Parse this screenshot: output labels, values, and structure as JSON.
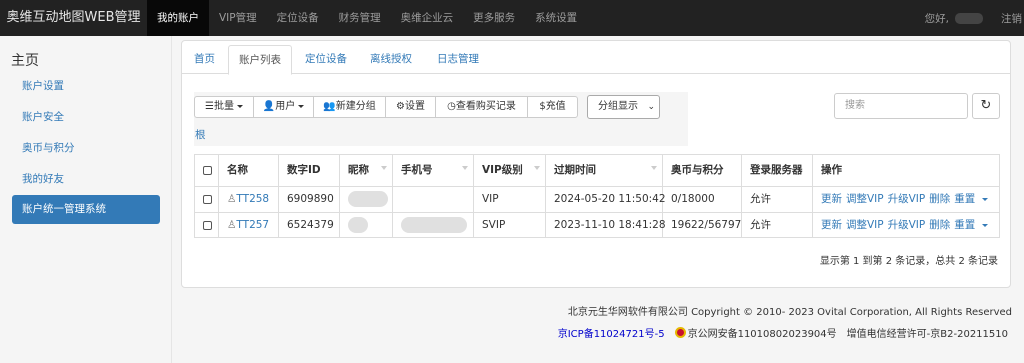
{
  "nav": {
    "brand": "奥维互动地图WEB管理",
    "items": [
      "我的账户",
      "VIP管理",
      "定位设备",
      "财务管理",
      "奥维企业云",
      "更多服务",
      "系统设置"
    ],
    "greeting": "您好,",
    "logout": "注销"
  },
  "sidebar": {
    "title": "主页",
    "items": [
      "账户设置",
      "账户安全",
      "奥币与积分",
      "我的好友",
      "账户统一管理系统"
    ]
  },
  "tabs": [
    "首页",
    "账户列表",
    "定位设备",
    "离线授权",
    "日志管理"
  ],
  "toolbar": {
    "batch": "批量",
    "user": "用户",
    "new_group": "新建分组",
    "settings": "设置",
    "purchase": "查看购买记录",
    "recharge": "充值",
    "group_display": "分组显示",
    "root": "根",
    "search_placeholder": "搜索"
  },
  "table": {
    "headers": [
      "名称",
      "数字ID",
      "昵称",
      "手机号",
      "VIP级别",
      "过期时间",
      "奥币与积分",
      "登录服务器",
      "操作"
    ],
    "rows": [
      {
        "name": "TT258",
        "id": "6909890",
        "vip": "VIP",
        "expire": "2024-05-20 11:50:42",
        "coins": "0/18000",
        "server": "允许"
      },
      {
        "name": "TT257",
        "id": "6524379",
        "vip": "SVIP",
        "expire": "2023-11-10 18:41:28",
        "coins": "19622/56797",
        "server": "允许"
      }
    ],
    "ops": [
      "更新",
      "调整VIP",
      "升级VIP",
      "删除",
      "重置"
    ],
    "summary": "显示第 1 到第 2 条记录，总共 2 条记录"
  },
  "footer": {
    "copyright": "北京元生华网软件有限公司 Copyright © 2010- 2023 Ovital Corporation, All Rights Reserved",
    "icp": "京ICP备11024721号-5",
    "police": "京公网安备11010802023904号",
    "license": "增值电信经营许可-京B2-20211510"
  },
  "colors": {
    "accent": "#337ab7",
    "navbar": "#222222"
  }
}
